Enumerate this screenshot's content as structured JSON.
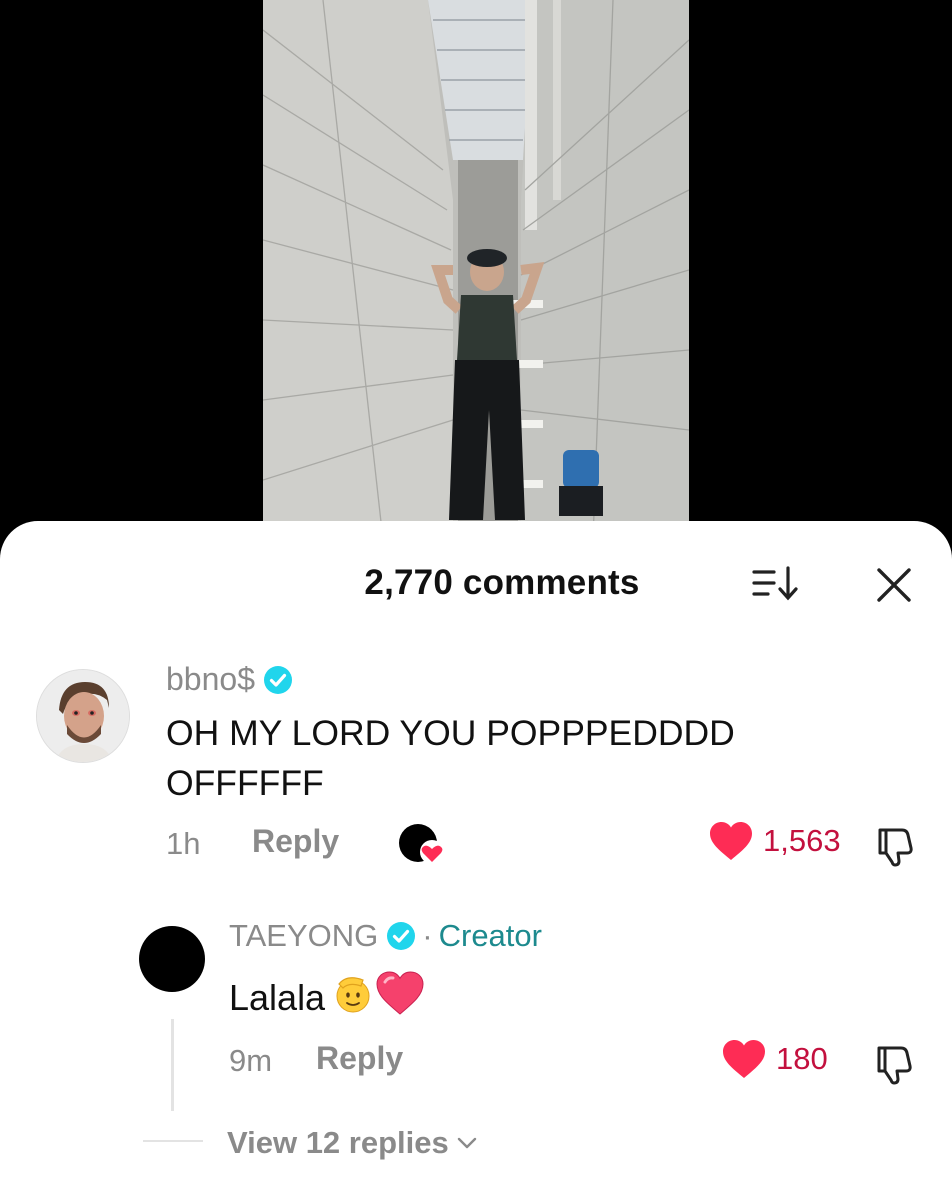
{
  "video": {
    "content": "dancer-in-corridor"
  },
  "comments_sheet": {
    "count_label": "2,770 comments",
    "sort_icon": "sort-descending-icon",
    "close_icon": "close-icon"
  },
  "comment": {
    "username": "bbno$",
    "verified": true,
    "text": "OH MY LORD YOU POPPPEDDDD OFFFFFF",
    "time": "1h",
    "reply_label": "Reply",
    "likes": "1,563",
    "creator_liked": true
  },
  "reply": {
    "username": "TAEYONG",
    "verified": true,
    "separator": "·",
    "role_tag": "Creator",
    "text": "Lalala",
    "emojis": [
      "🫡",
      "💗"
    ],
    "time": "9m",
    "reply_label": "Reply",
    "likes": "180"
  },
  "view_replies_label": "View 12 replies",
  "colors": {
    "like_red": "#fe2c55",
    "like_count": "#c3103e",
    "creator_teal": "#1d8a8e",
    "verified_cyan": "#20d5ec",
    "muted_text": "#8a8a8a"
  }
}
